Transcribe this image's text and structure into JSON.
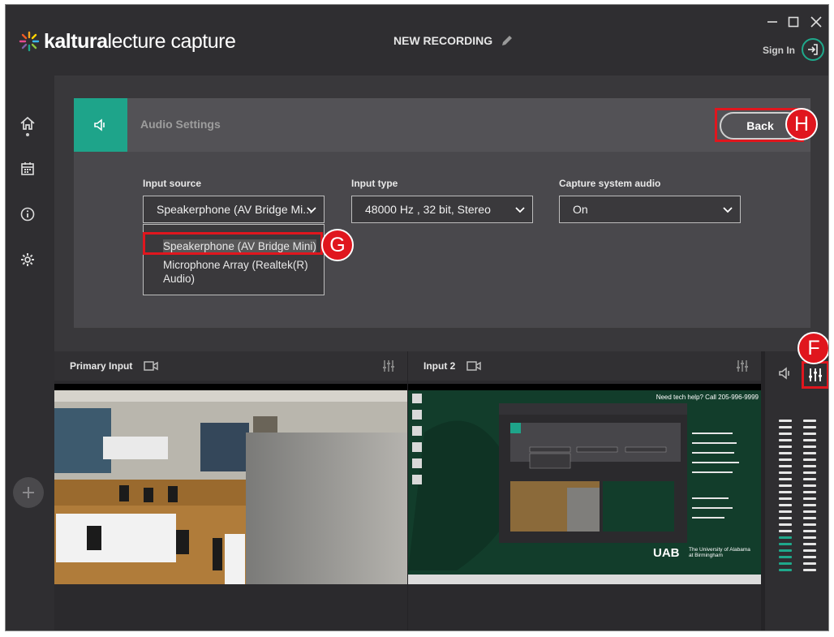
{
  "app": {
    "logo_bold": "kaltura",
    "logo_light": "lecture capture",
    "recording_title": "NEW RECORDING",
    "signin_label": "Sign In"
  },
  "audio_settings": {
    "title": "Audio Settings",
    "back_label": "Back",
    "input_source": {
      "label": "Input source",
      "value": "Speakerphone (AV Bridge Mi...",
      "options": [
        "Speakerphone (AV Bridge Mini)",
        "Microphone Array (Realtek(R) Audio)"
      ]
    },
    "input_type": {
      "label": "Input type",
      "value": "48000 Hz , 32 bit, Stereo"
    },
    "capture_system_audio": {
      "label": "Capture system audio",
      "value": "On"
    }
  },
  "inputs": [
    {
      "title": "Primary Input"
    },
    {
      "title": "Input 2"
    }
  ],
  "screen_preview": {
    "help_text": "Need tech help? Call 205-996-9999",
    "uab_logo": "UAB",
    "uab_sub": "The University of Alabama at Birmingham"
  },
  "audio_meter": {
    "left_level": 0.25,
    "right_level": 0.0
  },
  "annotations": {
    "back": "H",
    "option": "G",
    "mixer": "F"
  },
  "colors": {
    "accent": "#1ea48a",
    "highlight": "#e0161e"
  }
}
